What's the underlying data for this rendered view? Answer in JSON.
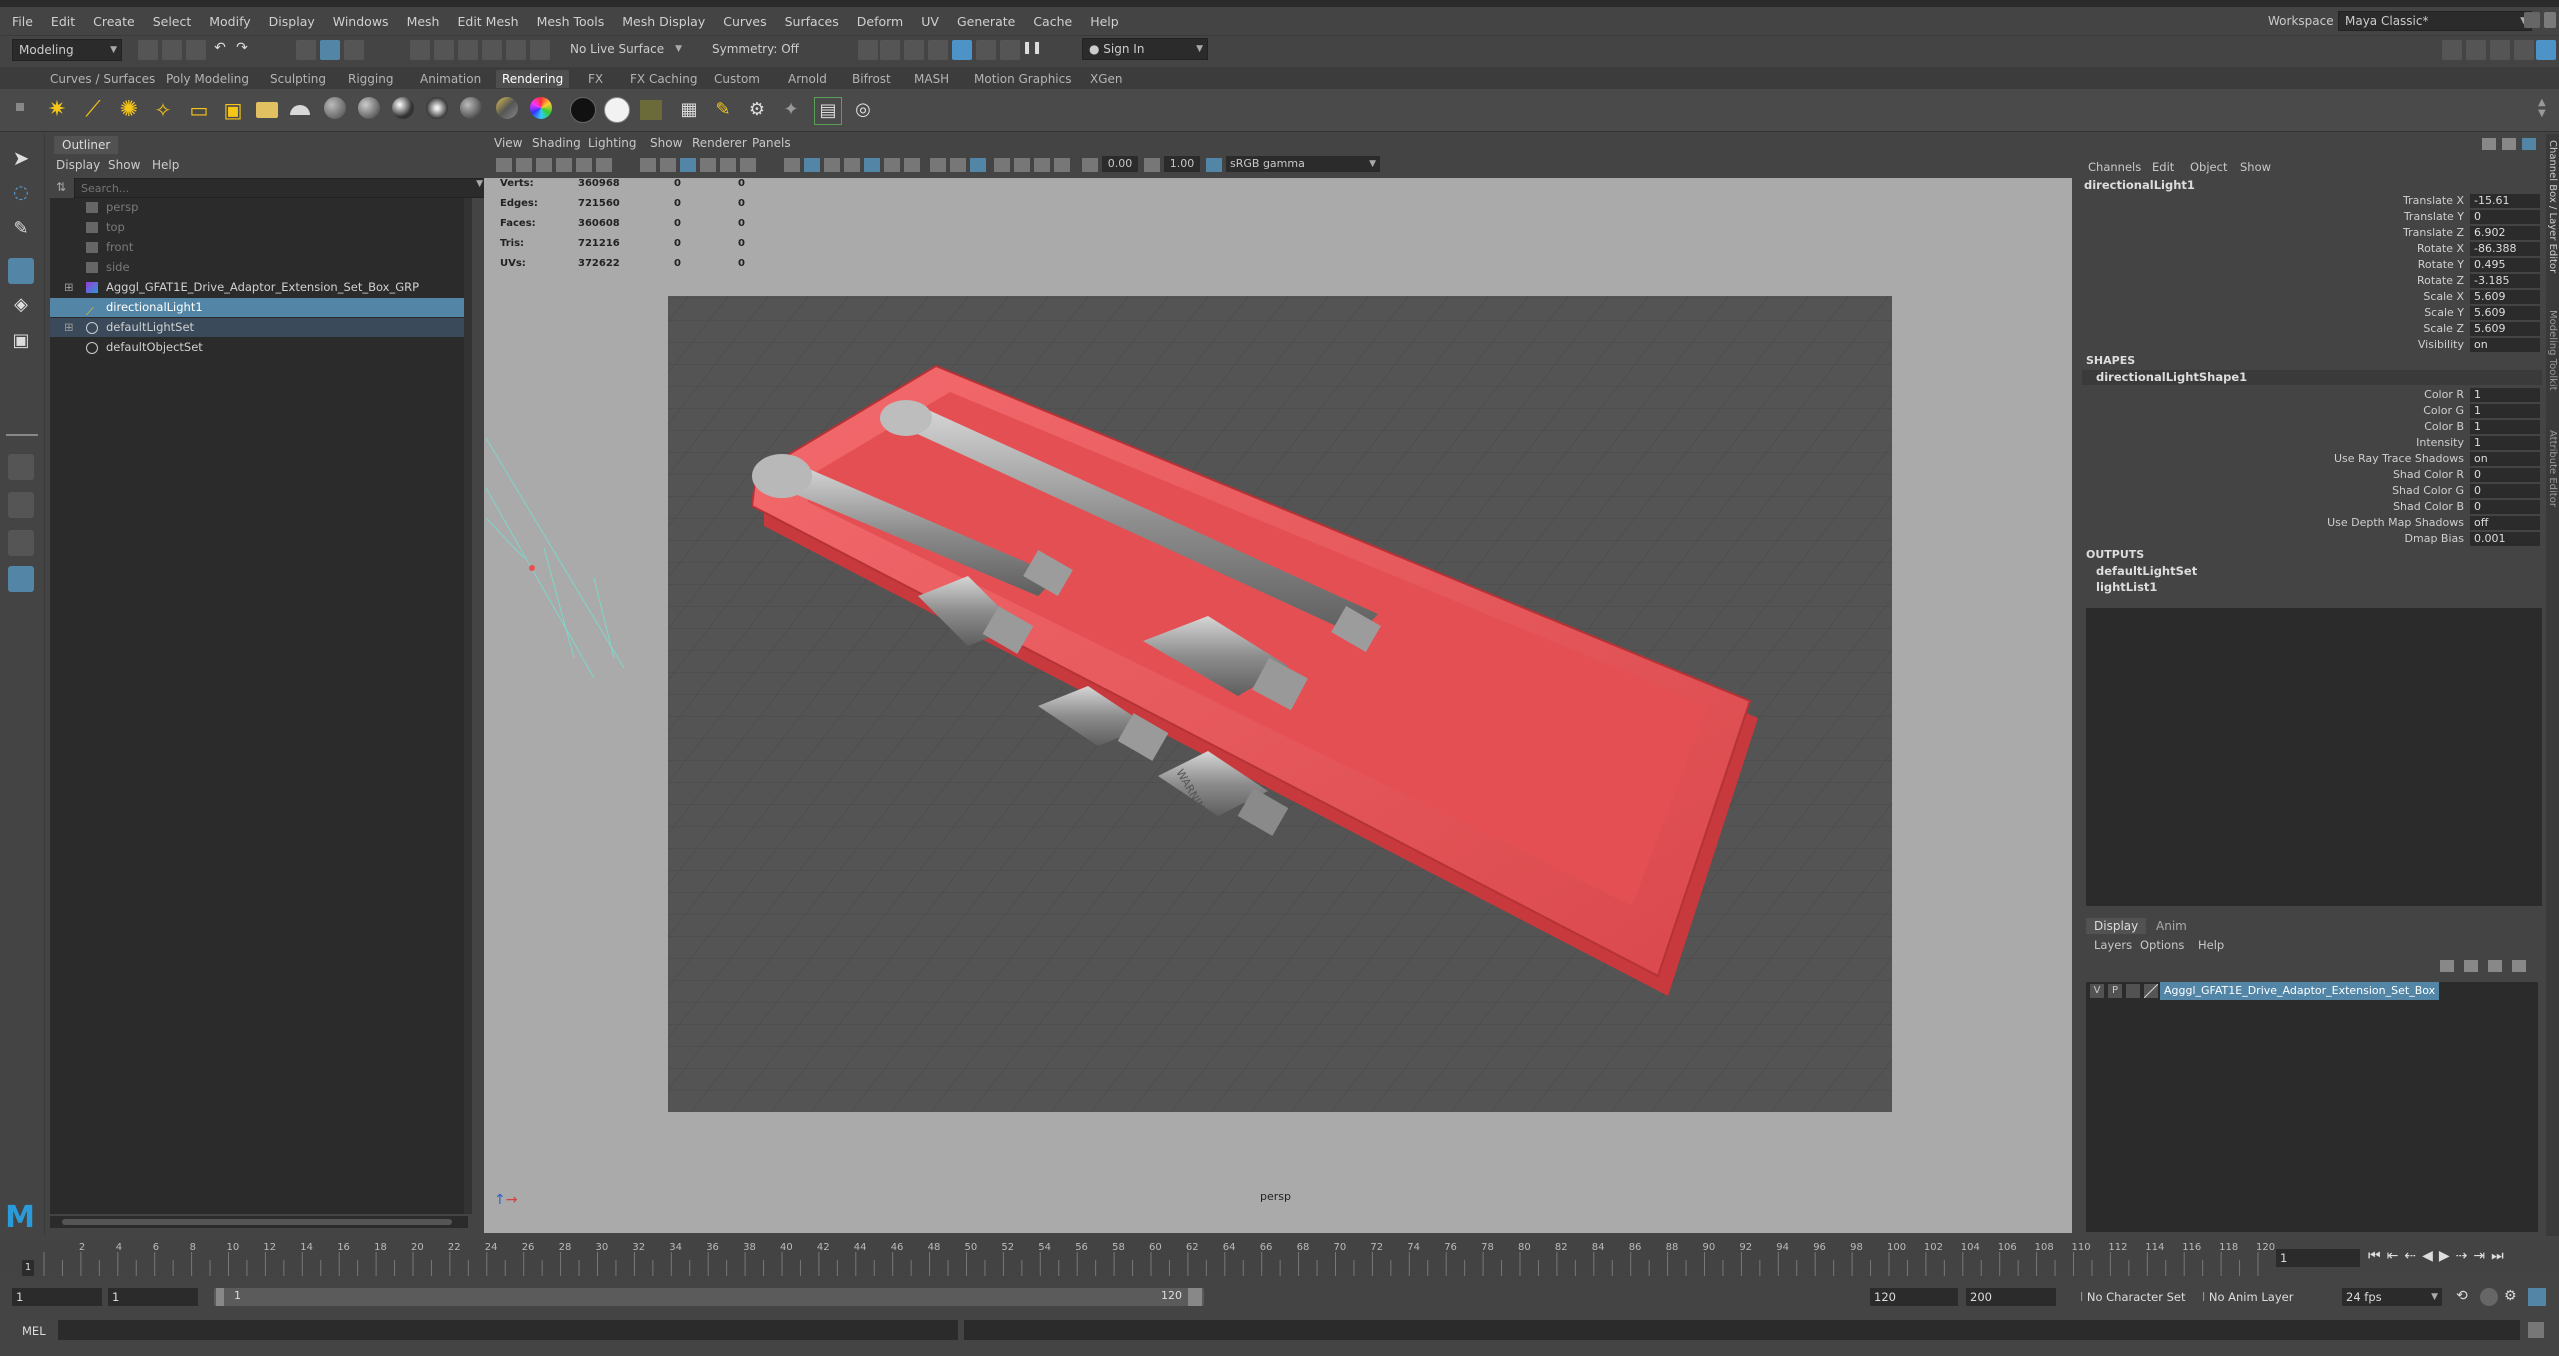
{
  "menubar": {
    "items": [
      "File",
      "Edit",
      "Create",
      "Select",
      "Modify",
      "Display",
      "Windows",
      "Mesh",
      "Edit Mesh",
      "Mesh Tools",
      "Mesh Display",
      "Curves",
      "Surfaces",
      "Deform",
      "UV",
      "Generate",
      "Cache",
      "Help"
    ],
    "workspace_label": "Workspace :",
    "workspace_value": "Maya Classic*"
  },
  "statusline": {
    "mode": "Modeling",
    "live_surface": "No Live Surface",
    "symmetry": "Symmetry: Off",
    "sign_in": "Sign In"
  },
  "shelf_tabs": [
    "Curves / Surfaces",
    "Poly Modeling",
    "Sculpting",
    "Rigging",
    "Animation",
    "Rendering",
    "FX",
    "FX Caching",
    "Custom",
    "Arnold",
    "Bifrost",
    "MASH",
    "Motion Graphics",
    "XGen"
  ],
  "active_shelf_tab": "Rendering",
  "outliner": {
    "title": "Outliner",
    "menu": [
      "Display",
      "Show",
      "Help"
    ],
    "search_placeholder": "Search...",
    "items": [
      {
        "label": "persp",
        "dim": true
      },
      {
        "label": "top",
        "dim": true
      },
      {
        "label": "front",
        "dim": true
      },
      {
        "label": "side",
        "dim": true
      },
      {
        "label": "Agggl_GFAT1E_Drive_Adaptor_Extension_Set_Box_GRP",
        "dim": false
      },
      {
        "label": "directionalLight1",
        "dim": false,
        "selected": true
      },
      {
        "label": "defaultLightSet",
        "dim": false
      },
      {
        "label": "defaultObjectSet",
        "dim": false
      }
    ]
  },
  "viewport": {
    "menu": [
      "View",
      "Shading",
      "Lighting",
      "Show",
      "Renderer",
      "Panels"
    ],
    "exposure": "0.00",
    "gamma": "1.00",
    "color_space": "sRGB gamma",
    "camera": "persp",
    "hud": [
      {
        "label": "Verts:",
        "v1": "360968",
        "v2": "0",
        "v3": "0"
      },
      {
        "label": "Edges:",
        "v1": "721560",
        "v2": "0",
        "v3": "0"
      },
      {
        "label": "Faces:",
        "v1": "360608",
        "v2": "0",
        "v3": "0"
      },
      {
        "label": "Tris:",
        "v1": "721216",
        "v2": "0",
        "v3": "0"
      },
      {
        "label": "UVs:",
        "v1": "372622",
        "v2": "0",
        "v3": "0"
      }
    ],
    "warning_text": "WARNING"
  },
  "channelbox": {
    "menu": [
      "Channels",
      "Edit",
      "Object",
      "Show"
    ],
    "node": "directionalLight1",
    "channels": [
      {
        "label": "Translate X",
        "value": "-15.61"
      },
      {
        "label": "Translate Y",
        "value": "0"
      },
      {
        "label": "Translate Z",
        "value": "6.902"
      },
      {
        "label": "Rotate X",
        "value": "-86.388"
      },
      {
        "label": "Rotate Y",
        "value": "0.495"
      },
      {
        "label": "Rotate Z",
        "value": "-3.185"
      },
      {
        "label": "Scale X",
        "value": "5.609"
      },
      {
        "label": "Scale Y",
        "value": "5.609"
      },
      {
        "label": "Scale Z",
        "value": "5.609"
      },
      {
        "label": "Visibility",
        "value": "on"
      }
    ],
    "shapes_header": "SHAPES",
    "shape_node": "directionalLightShape1",
    "shape_channels": [
      {
        "label": "Color R",
        "value": "1"
      },
      {
        "label": "Color G",
        "value": "1"
      },
      {
        "label": "Color B",
        "value": "1"
      },
      {
        "label": "Intensity",
        "value": "1"
      },
      {
        "label": "Use Ray Trace Shadows",
        "value": "on"
      },
      {
        "label": "Shad Color R",
        "value": "0"
      },
      {
        "label": "Shad Color G",
        "value": "0"
      },
      {
        "label": "Shad Color B",
        "value": "0"
      },
      {
        "label": "Use Depth Map Shadows",
        "value": "off"
      },
      {
        "label": "Dmap Bias",
        "value": "0.001"
      }
    ],
    "outputs_header": "OUTPUTS",
    "outputs": [
      "defaultLightSet",
      "lightList1"
    ]
  },
  "right_strip_tabs": [
    "Channel Box / Layer Editor",
    "Modeling Toolkit",
    "Attribute Editor"
  ],
  "layers": {
    "tabs": [
      "Display",
      "Anim"
    ],
    "menu": [
      "Layers",
      "Options",
      "Help"
    ],
    "layer_v": "V",
    "layer_p": "P",
    "layer_name": "Agggl_GFAT1E_Drive_Adaptor_Extension_Set_Box"
  },
  "timeline": {
    "ticks": [
      "2",
      "4",
      "6",
      "8",
      "10",
      "12",
      "14",
      "16",
      "18",
      "20",
      "22",
      "24",
      "26",
      "28",
      "30",
      "32",
      "34",
      "36",
      "38",
      "40",
      "42",
      "44",
      "46",
      "48",
      "50",
      "52",
      "54",
      "56",
      "58",
      "60",
      "62",
      "64",
      "66",
      "68",
      "70",
      "72",
      "74",
      "76",
      "78",
      "80",
      "82",
      "84",
      "86",
      "88",
      "90",
      "92",
      "94",
      "96",
      "98",
      "100",
      "102",
      "104",
      "106",
      "108",
      "110",
      "112",
      "114",
      "116",
      "118",
      "120"
    ],
    "current_frame_marker": "1",
    "current_frame": "1"
  },
  "range": {
    "start": "1",
    "playback_start": "1",
    "slider_start": "1",
    "slider_end": "120",
    "playback_end": "120",
    "end": "200",
    "character_set": "No Character Set",
    "anim_layer": "No Anim Layer",
    "fps": "24 fps"
  },
  "cmdline": {
    "label": "MEL"
  },
  "colors": {
    "accent_blue": "#5285a6",
    "tray_red": "#e8575b",
    "viewport_bg": "#545454",
    "panel_bg": "#444444"
  }
}
